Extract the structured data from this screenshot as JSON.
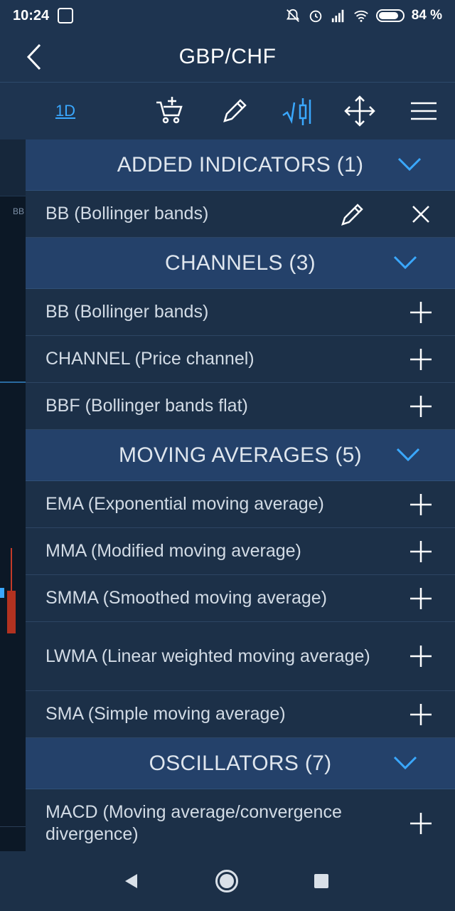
{
  "status_bar": {
    "time": "10:24",
    "battery_label": "84 %",
    "battery_level": 0.84,
    "icons": [
      "screenshot-icon",
      "mute-icon",
      "alarm-icon",
      "signal-icon",
      "wifi-icon",
      "battery-icon"
    ]
  },
  "header": {
    "title": "GBP/CHF",
    "back_icon": "chevron-left-icon"
  },
  "toolbar": {
    "period_label": "1D",
    "items": [
      "add-to-cart-icon",
      "pencil-icon",
      "indicator-icon",
      "move-icon",
      "menu-icon"
    ],
    "active_item": "indicator-icon"
  },
  "chart": {
    "indicator_tag": "BB"
  },
  "panel": {
    "added": {
      "title": "ADDED INDICATORS (1)",
      "items": [
        {
          "label": "BB (Bollinger bands)"
        }
      ]
    },
    "channels": {
      "title": "CHANNELS (3)",
      "items": [
        {
          "label": "BB (Bollinger bands)"
        },
        {
          "label": "CHANNEL (Price channel)"
        },
        {
          "label": "BBF (Bollinger bands flat)"
        }
      ]
    },
    "moving_averages": {
      "title": "MOVING AVERAGES (5)",
      "items": [
        {
          "label": "EMA (Exponential moving average)"
        },
        {
          "label": "MMA (Modified moving average)"
        },
        {
          "label": "SMMA (Smoothed moving average)"
        },
        {
          "label": "LWMA (Linear weighted moving average)"
        },
        {
          "label": "SMA (Simple moving average)"
        }
      ]
    },
    "oscillators": {
      "title": "OSCILLATORS (7)",
      "items": [
        {
          "label": "MACD (Moving average/convergence divergence)"
        }
      ]
    }
  },
  "navbar": {
    "icons": [
      "back-triangle-icon",
      "home-circle-icon",
      "recents-square-icon"
    ]
  },
  "colors": {
    "accent": "#3aa8ff",
    "section_bg": "#24416a",
    "row_bg": "#1c3048",
    "bar_bg": "#1e3450"
  }
}
